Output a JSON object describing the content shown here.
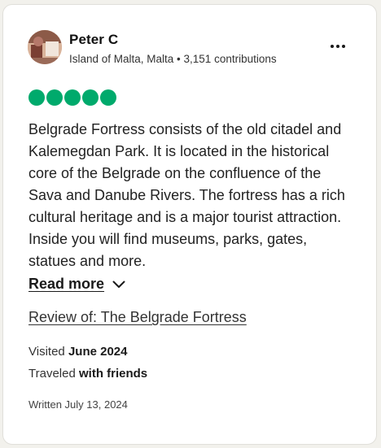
{
  "review": {
    "author": {
      "name": "Peter C",
      "meta": "Island of Malta, Malta • 3,151 contributions"
    },
    "more_menu_icon": "more-dots-icon",
    "rating": 5,
    "rating_color": "#00aa6c",
    "text": "Belgrade Fortress consists of the old citadel and Kalemegdan Park. It is located in the historical core of the Belgrade on the confluence of the Sava and Danube Rivers. The fortress has a rich cultural heritage and is a major tourist attraction. Inside you will find museums, parks, gates, statues and more.",
    "read_more_label": "Read more",
    "review_of": "Review of: The Belgrade Fortress",
    "visited_label": "Visited",
    "visited_value": "June 2024",
    "traveled_label": "Traveled",
    "traveled_value": "with friends",
    "written": "Written July 13, 2024"
  }
}
